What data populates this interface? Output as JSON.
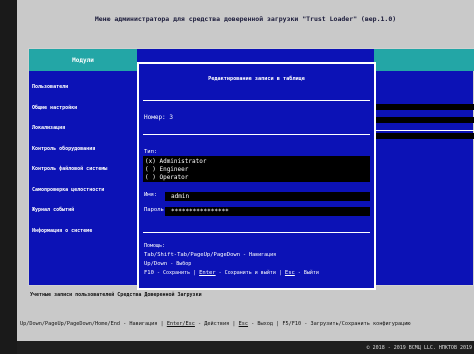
{
  "header": {
    "title": "Меню администратора для средства доверенной загрузки \"Trust Loader\" (вер.1.0)"
  },
  "menu": {
    "title": "Модули",
    "items": [
      "Пользователи",
      "Общие настройки",
      "Локализация",
      "Контроль оборудования",
      "Контроль файловой системы",
      "Самопроверка целостности",
      "Журнал событий",
      "Информация о системе"
    ]
  },
  "dialog": {
    "title": "Редактирование записи в таблице",
    "number_label": "Номер:",
    "number_value": "3",
    "type_label": "Тип:",
    "roles": [
      {
        "mark": "(x)",
        "label": "Administrator"
      },
      {
        "mark": "( )",
        "label": "Engineer"
      },
      {
        "mark": "( )",
        "label": "Operator"
      }
    ],
    "name_label": "Имя:",
    "name_value": "admin",
    "password_label": "Пароль:",
    "password_value": "****************",
    "help_label": "Помощь:",
    "help_nav_keys": "Tab/Shift-Tab/PageUp/PageDown",
    "help_nav_desc": " - Навигация",
    "help_select_keys": "Up/Down",
    "help_select_desc": " - Выбор",
    "help_f10": "F10",
    "help_save": " - Сохранить | ",
    "help_enter": "Enter",
    "help_save_exit": " - Сохранить и выйти | ",
    "help_esc": "Esc",
    "help_exit": " - Выйти"
  },
  "status": {
    "text": "Учетные записи пользователей Средства Доверенной Загрузки"
  },
  "hotkeys": {
    "nav_keys": "Up/Down/PageUp/PageDown/Home/End",
    "nav_desc": " - Навигация | ",
    "enter_keys": "Enter/Esc",
    "enter_desc": " - Действия | ",
    "esc_key": "Esc",
    "esc_desc": " - Выход | ",
    "f5_keys": "F5/F10",
    "f5_desc": " - Загрузить/Сохранить конфигурацию"
  },
  "footer": {
    "copyright": "© 2018 - 2019 ВСМЦ LLC. НПКТОВ 2019"
  },
  "colors": {
    "background_blue": "#0c12b6",
    "header_teal": "#23a6a6",
    "frame_gray": "#c9c9c9"
  }
}
